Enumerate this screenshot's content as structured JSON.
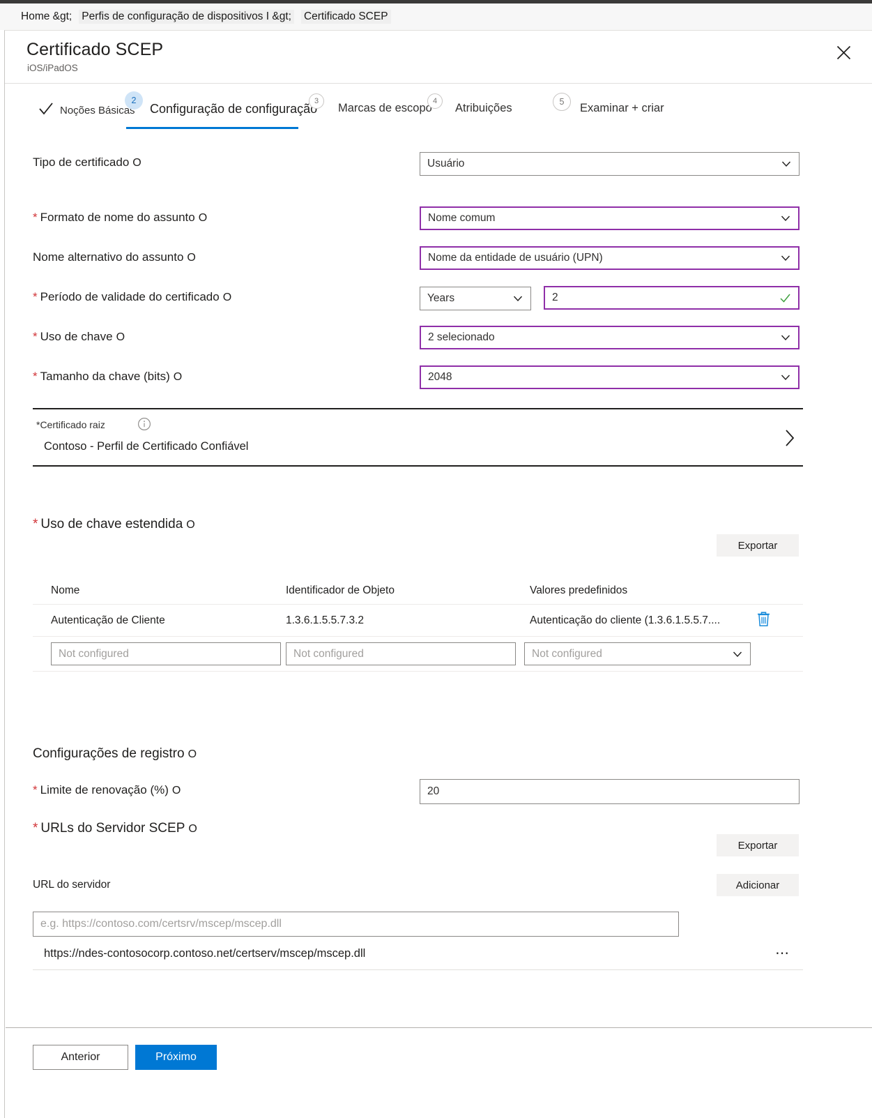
{
  "breadcrumb": {
    "home": "Home &gt;",
    "profiles": "Perfis de configuração de dispositivos I &gt;",
    "current": "Certificado SCEP"
  },
  "blade": {
    "title": "Certificado SCEP",
    "subtitle": "iOS/iPadOS",
    "close_icon": "close-icon"
  },
  "steps": [
    {
      "label": "Noções Básicas",
      "badge": "check",
      "state": "completed"
    },
    {
      "label": "Configuração de configuração",
      "badge": "2",
      "state": "active"
    },
    {
      "label": "Marcas de escopo",
      "badge": "3",
      "state": "upcoming"
    },
    {
      "label": "Atribuições",
      "badge": "4",
      "state": "upcoming"
    },
    {
      "label": "Examinar + criar",
      "badge": "5",
      "state": "upcoming"
    }
  ],
  "fields": {
    "certificate_type": {
      "label": "Tipo de certificado",
      "value": "Usuário",
      "required": false
    },
    "subject_name_format": {
      "label": "Formato de nome do assunto",
      "value": "Nome comum",
      "required": true
    },
    "subject_alternative_name": {
      "label": "Nome alternativo do assunto",
      "value": "Nome da entidade de usuário (UPN)",
      "required": false
    },
    "validity_period": {
      "label": "Período de validade do certificado",
      "unit": "Years",
      "value": "2",
      "required": true
    },
    "key_usage": {
      "label": "Uso de chave",
      "value": "2 selecionado",
      "required": true
    },
    "key_size": {
      "label": "Tamanho da chave (bits)",
      "value": "2048",
      "required": true
    }
  },
  "root_certificate": {
    "label": "*Certificado raiz",
    "value": "Contoso - Perfil de Certificado Confiável",
    "info_icon": "info-circle-icon",
    "chevron_icon": "chevron-right-icon"
  },
  "extended_key_usage": {
    "label": "Uso de chave estendida",
    "required": true,
    "export_label": "Exportar",
    "columns": [
      "Nome",
      "Identificador de Objeto",
      "Valores predefinidos"
    ],
    "rows": [
      {
        "name": "Autenticação de Cliente",
        "object_identifier": "1.3.6.1.5.5.7.3.2",
        "predefined_value": "Autenticação do cliente (1.3.6.1.5.5.7....",
        "delete_icon": "trash-icon"
      }
    ],
    "new_row": {
      "name_placeholder": "Not configured",
      "oid_placeholder": "Not configured",
      "predefined_placeholder": "Not configured"
    }
  },
  "enrollment_settings": {
    "label": "Configurações de registro",
    "renewal_threshold": {
      "label": "Limite de renovação (%)",
      "value": "20",
      "required": true
    }
  },
  "scep_urls": {
    "label": "URLs do Servidor SCEP",
    "required": true,
    "export_label": "Exportar",
    "add_label": "Adicionar",
    "field_label": "URL do servidor",
    "placeholder": "e.g. https://contoso.com/certsrv/mscep/mscep.dll",
    "items": [
      {
        "url": "https://ndes-contosocorp.contoso.net/certserv/mscep/mscep.dll",
        "menu_icon": "ellipsis-icon"
      }
    ]
  },
  "footer": {
    "previous": "Anterior",
    "next": "Próximo"
  },
  "colors": {
    "accent": "#0078d4",
    "modified_border": "#8f2fa8",
    "required_asterisk": "#d13438",
    "valid_check": "#3fa03f",
    "icon_blue": "#1a8cdb"
  }
}
